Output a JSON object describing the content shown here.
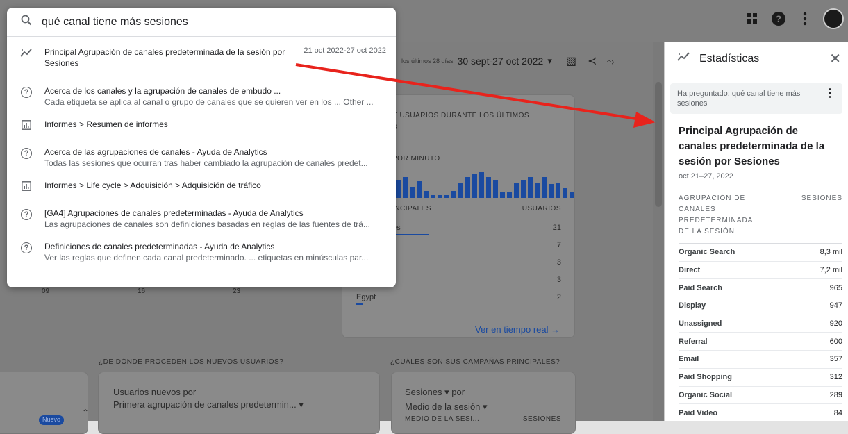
{
  "search": {
    "query": "qué canal tiene más sesiones",
    "suggestions": [
      {
        "icon": "insights-icon",
        "title": "Principal Agrupación de canales predeterminada de la sesión por",
        "title2": "Sesiones",
        "date": "21 oct 2022-27 oct 2022"
      },
      {
        "icon": "help-icon",
        "title": "Acerca de los canales y la agrupación de canales de embudo ...",
        "sub": "Cada etiqueta se aplica al canal o grupo de canales que se quieren ver en los ... Other ..."
      },
      {
        "icon": "report-icon",
        "title": "Informes > Resumen de informes"
      },
      {
        "icon": "help-icon",
        "title": "Acerca de las agrupaciones de canales - Ayuda de Analytics",
        "sub": "Todas las sesiones que ocurran tras haber cambiado la agrupación de canales predet..."
      },
      {
        "icon": "report-icon",
        "title": "Informes > Life cycle > Adquisición > Adquisición de tráfico"
      },
      {
        "icon": "help-icon",
        "title": "[GA4] Agrupaciones de canales predeterminadas - Ayuda de Analytics",
        "sub": "Las agrupaciones de canales son definiciones basadas en reglas de las fuentes de trá..."
      },
      {
        "icon": "help-icon",
        "title": "Definiciones de canales predeterminadas - Ayuda de Analytics",
        "sub": "Ver las reglas que definen cada canal predeterminado. ... etiquetas en minúsculas par..."
      }
    ]
  },
  "background": {
    "date_small": "los últimos 28 días",
    "date_range": "30 sept-27 oct 2022",
    "card1_title": "E USUARIOS DURANTE LOS ÚLTIMOS",
    "card1_title2": "S",
    "per_minute": "POR MINUTO",
    "principales": "INCIPALES",
    "usuarios": "USUARIOS",
    "rows": [
      {
        "label": "es",
        "value": "21"
      },
      {
        "label": "",
        "value": "7"
      },
      {
        "label": "",
        "value": "3"
      },
      {
        "label": "",
        "value": "3"
      },
      {
        "label": "Egypt",
        "value": "2"
      }
    ],
    "axis": [
      "09",
      "16",
      "23"
    ],
    "ver_link": "Ver en tiempo real →",
    "new_users_q": "¿DE DÓNDE PROCEDEN LOS NUEVOS USUARIOS?",
    "campaigns_q": "¿CUÁLES SON SUS CAMPAÑAS PRINCIPALES?",
    "nu_line1": "Usuarios nuevos por",
    "nu_line2": "Primera agrupación de canales predetermin... ▾",
    "camp_line1": "Sesiones ▾ por",
    "camp_line2": "Medio de la sesión ▾",
    "camp_col1": "MEDIO DE LA SESI...",
    "camp_col2": "SESIONES",
    "badge": "Nuevo"
  },
  "panel": {
    "title": "Estadísticas",
    "asked": "Ha preguntado: qué canal tiene más sesiones",
    "answer_title": "Principal Agrupación de canales predeterminada de la sesión por Sesiones",
    "answer_date": "oct 21–27, 2022",
    "col1": "AGRUPACIÓN DE CANALES PREDETERMINADA DE LA SESIÓN",
    "col2": "SESIONES",
    "rows": [
      {
        "label": "Organic Search",
        "value": "8,3 mil"
      },
      {
        "label": "Direct",
        "value": "7,2 mil"
      },
      {
        "label": "Paid Search",
        "value": "965"
      },
      {
        "label": "Display",
        "value": "947"
      },
      {
        "label": "Unassigned",
        "value": "920"
      },
      {
        "label": "Referral",
        "value": "600"
      },
      {
        "label": "Email",
        "value": "357"
      },
      {
        "label": "Paid Shopping",
        "value": "312"
      },
      {
        "label": "Organic Social",
        "value": "289"
      },
      {
        "label": "Paid Video",
        "value": "84"
      }
    ]
  },
  "colors": {
    "accent": "#1a4aa0",
    "arrow": "#e8231c"
  }
}
